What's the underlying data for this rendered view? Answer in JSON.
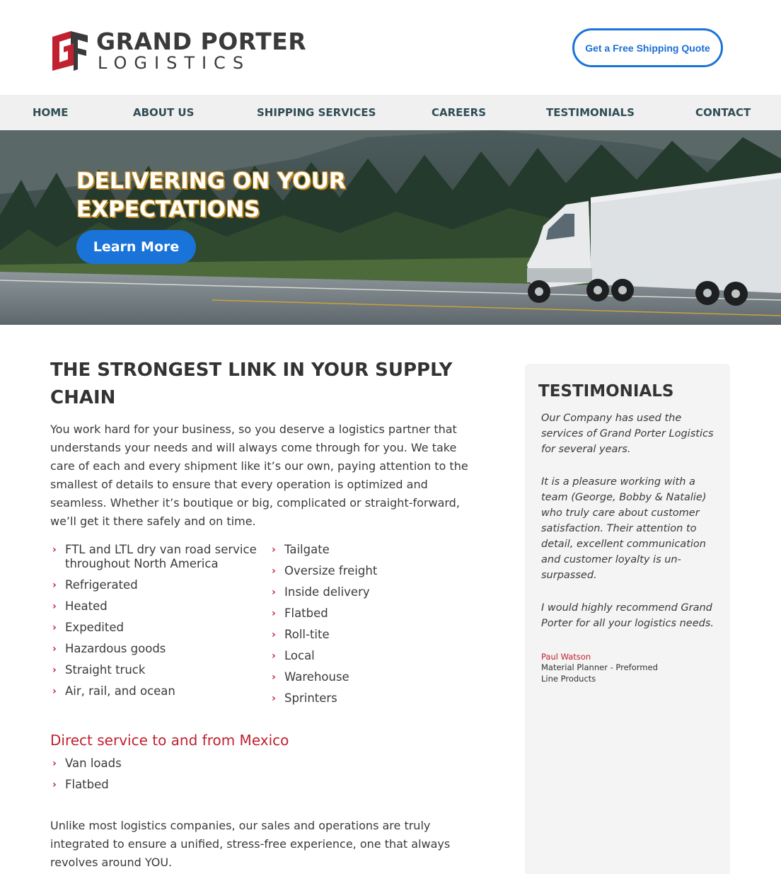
{
  "header": {
    "logo_name": "GRAND PORTER",
    "logo_sub": "LOGISTICS",
    "quote_button": "Get a Free Shipping Quote"
  },
  "nav": {
    "items": [
      {
        "label": "HOME"
      },
      {
        "label": "ABOUT US"
      },
      {
        "label": "SHIPPING SERVICES"
      },
      {
        "label": "CAREERS"
      },
      {
        "label": "TESTIMONIALS"
      },
      {
        "label": "CONTACT"
      }
    ]
  },
  "hero": {
    "title": "DELIVERING ON YOUR EXPECTATIONS",
    "button": "Learn More"
  },
  "main": {
    "title": "THE STRONGEST LINK IN YOUR SUPPLY CHAIN",
    "intro": "You work hard for your business, so you deserve a logistics partner that understands your needs and will always come through for you. We take care of each and every shipment like it’s our own, paying attention to the smallest of details to ensure that every operation is optimized and seamless. Whether it’s boutique or big, complicated or straight-forward, we’ll get it there safely and on time.",
    "services_col1": [
      "FTL and LTL dry van road service throughout North America",
      "Refrigerated",
      "Heated",
      "Expedited",
      "Hazardous goods",
      "Straight truck",
      "Air, rail, and ocean"
    ],
    "services_col2": [
      "Tailgate",
      "Oversize freight",
      "Inside delivery",
      "Flatbed",
      "Roll-tite",
      "Local",
      "Warehouse",
      "Sprinters"
    ],
    "mexico_heading": "Direct service to and from Mexico",
    "mexico_services": [
      "Van loads",
      "Flatbed"
    ],
    "outro": "Unlike most logistics companies, our sales and operations are truly integrated to ensure a unified, stress-free experience, one that always revolves around YOU."
  },
  "sidebar": {
    "title": "TESTIMONIALS",
    "paragraphs": [
      "Our Company has used the services of Grand Porter Logistics for several years.",
      "It is a pleasure working with a team (George, Bobby & Natalie) who truly care about customer satisfaction. Their attention to detail, excellent communication and customer loyalty is un-surpassed.",
      "I would highly recommend Grand Porter for all your logistics needs."
    ],
    "author": "Paul Watson",
    "role": "Material Planner - Preformed Line Products"
  },
  "colors": {
    "brand_red": "#c0202f",
    "accent_blue": "#1a73d8",
    "nav_text": "#2f4d55",
    "nav_bg": "#f0f0f0"
  },
  "icons": {
    "list_bullet": "chevron-right-icon"
  }
}
